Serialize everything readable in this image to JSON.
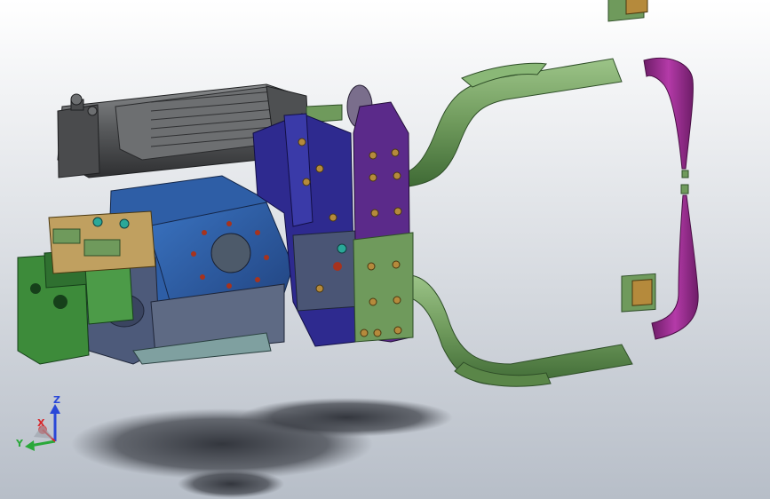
{
  "colors": {
    "background_top": "#ffffff",
    "background_bottom": "#b7bec8",
    "motor": "#5a5c5e",
    "motor_dark": "#3a3b3d",
    "arm_green": "#6f9a5c",
    "arm_green_dark": "#3f6a35",
    "electrode_purple": "#9b2d91",
    "plate_indigo": "#2e2a8f",
    "plate_purple": "#5b2a8a",
    "housing_blue": "#2e5ea6",
    "gearbox_green": "#3d8b3a",
    "frame_slate": "#4d5a7a",
    "bronze": "#b58a3c",
    "shadow": "#3a3d44",
    "triad_x": "#d8262a",
    "triad_y": "#2aa83a",
    "triad_z": "#2a48d8"
  },
  "triad": {
    "x_label": "X",
    "y_label": "Y",
    "z_label": "Z"
  },
  "icons": [
    "coordinate-triad-icon"
  ]
}
